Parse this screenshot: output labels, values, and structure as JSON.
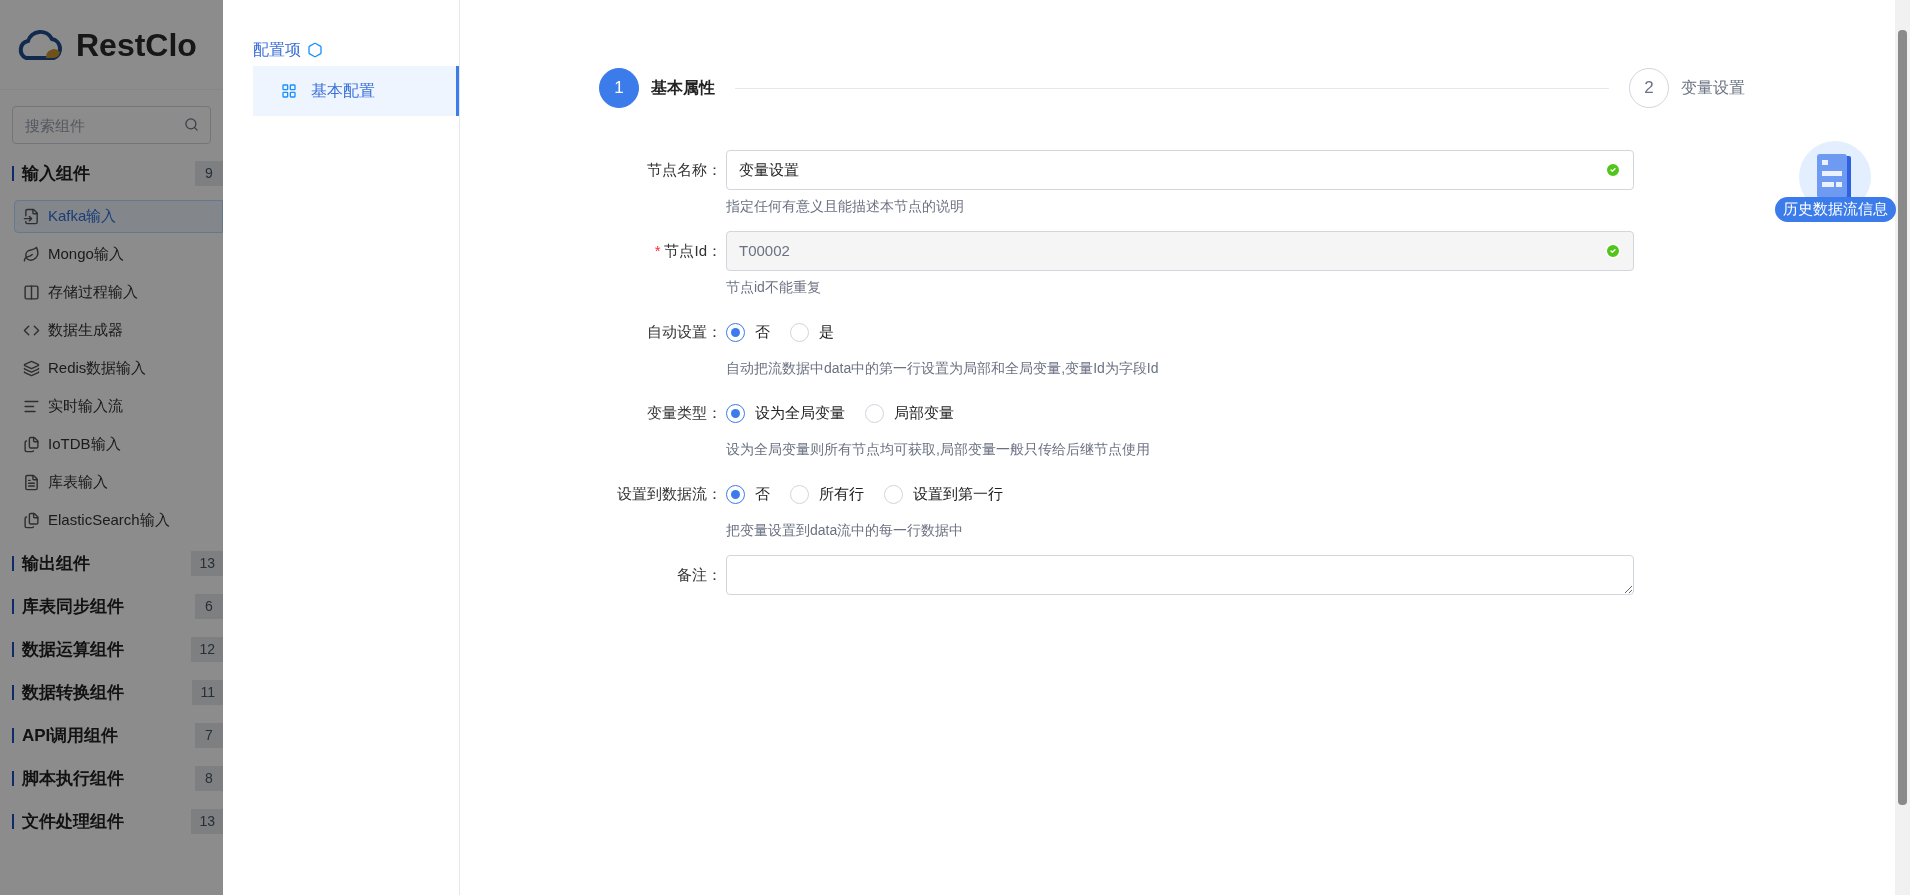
{
  "sidebar": {
    "logo_text": "RestClo",
    "search": {
      "placeholder": "搜索组件"
    },
    "groups": [
      {
        "title": "输入组件",
        "count": "9",
        "items": [
          {
            "label": "Kafka输入",
            "selected": true
          },
          {
            "label": "Mongo输入",
            "selected": false
          },
          {
            "label": "存储过程输入",
            "selected": false
          },
          {
            "label": "数据生成器",
            "selected": false
          },
          {
            "label": "Redis数据输入",
            "selected": false
          },
          {
            "label": "实时输入流",
            "selected": false
          },
          {
            "label": "IoTDB输入",
            "selected": false
          },
          {
            "label": "库表输入",
            "selected": false
          },
          {
            "label": "ElasticSearch输入",
            "selected": false
          }
        ]
      },
      {
        "title": "输出组件",
        "count": "13"
      },
      {
        "title": "库表同步组件",
        "count": "6"
      },
      {
        "title": "数据运算组件",
        "count": "12"
      },
      {
        "title": "数据转换组件",
        "count": "11"
      },
      {
        "title": "API调用组件",
        "count": "7"
      },
      {
        "title": "脚本执行组件",
        "count": "8"
      },
      {
        "title": "文件处理组件",
        "count": "13"
      }
    ]
  },
  "drawer": {
    "menu_title": "配置项",
    "menu": [
      {
        "label": "基本配置",
        "selected": true
      }
    ],
    "steps": [
      {
        "number": "1",
        "label": "基本属性",
        "selected": true
      },
      {
        "number": "2",
        "label": "变量设置",
        "selected": false
      }
    ],
    "fields": [
      {
        "kind": "text",
        "label": "节点名称：",
        "value": "变量设置",
        "valid": true,
        "disabled": false,
        "hint": "指定任何有意义且能描述本节点的说明"
      },
      {
        "kind": "text",
        "label": "节点Id：",
        "required_mark": "*",
        "value": "T00002",
        "valid": true,
        "disabled": true,
        "hint": "节点id不能重复"
      },
      {
        "kind": "radio",
        "label": "自动设置：",
        "options": [
          {
            "label": "否",
            "selected": true
          },
          {
            "label": "是",
            "selected": false
          }
        ],
        "hint": "自动把流数据中data中的第一行设置为局部和全局变量,变量Id为字段Id"
      },
      {
        "kind": "radio",
        "label": "变量类型：",
        "options": [
          {
            "label": "设为全局变量",
            "selected": true
          },
          {
            "label": "局部变量",
            "selected": false
          }
        ],
        "hint": "设为全局变量则所有节点均可获取,局部变量一般只传给后继节点使用"
      },
      {
        "kind": "radio",
        "label": "设置到数据流：",
        "options": [
          {
            "label": "否",
            "selected": true
          },
          {
            "label": "所有行",
            "selected": false
          },
          {
            "label": "设置到第一行",
            "selected": false
          }
        ],
        "hint": "把变量设置到data流中的每一行数据中"
      },
      {
        "kind": "textarea",
        "label": "备注："
      }
    ]
  },
  "history_button": {
    "label": "历史数据流信息"
  }
}
